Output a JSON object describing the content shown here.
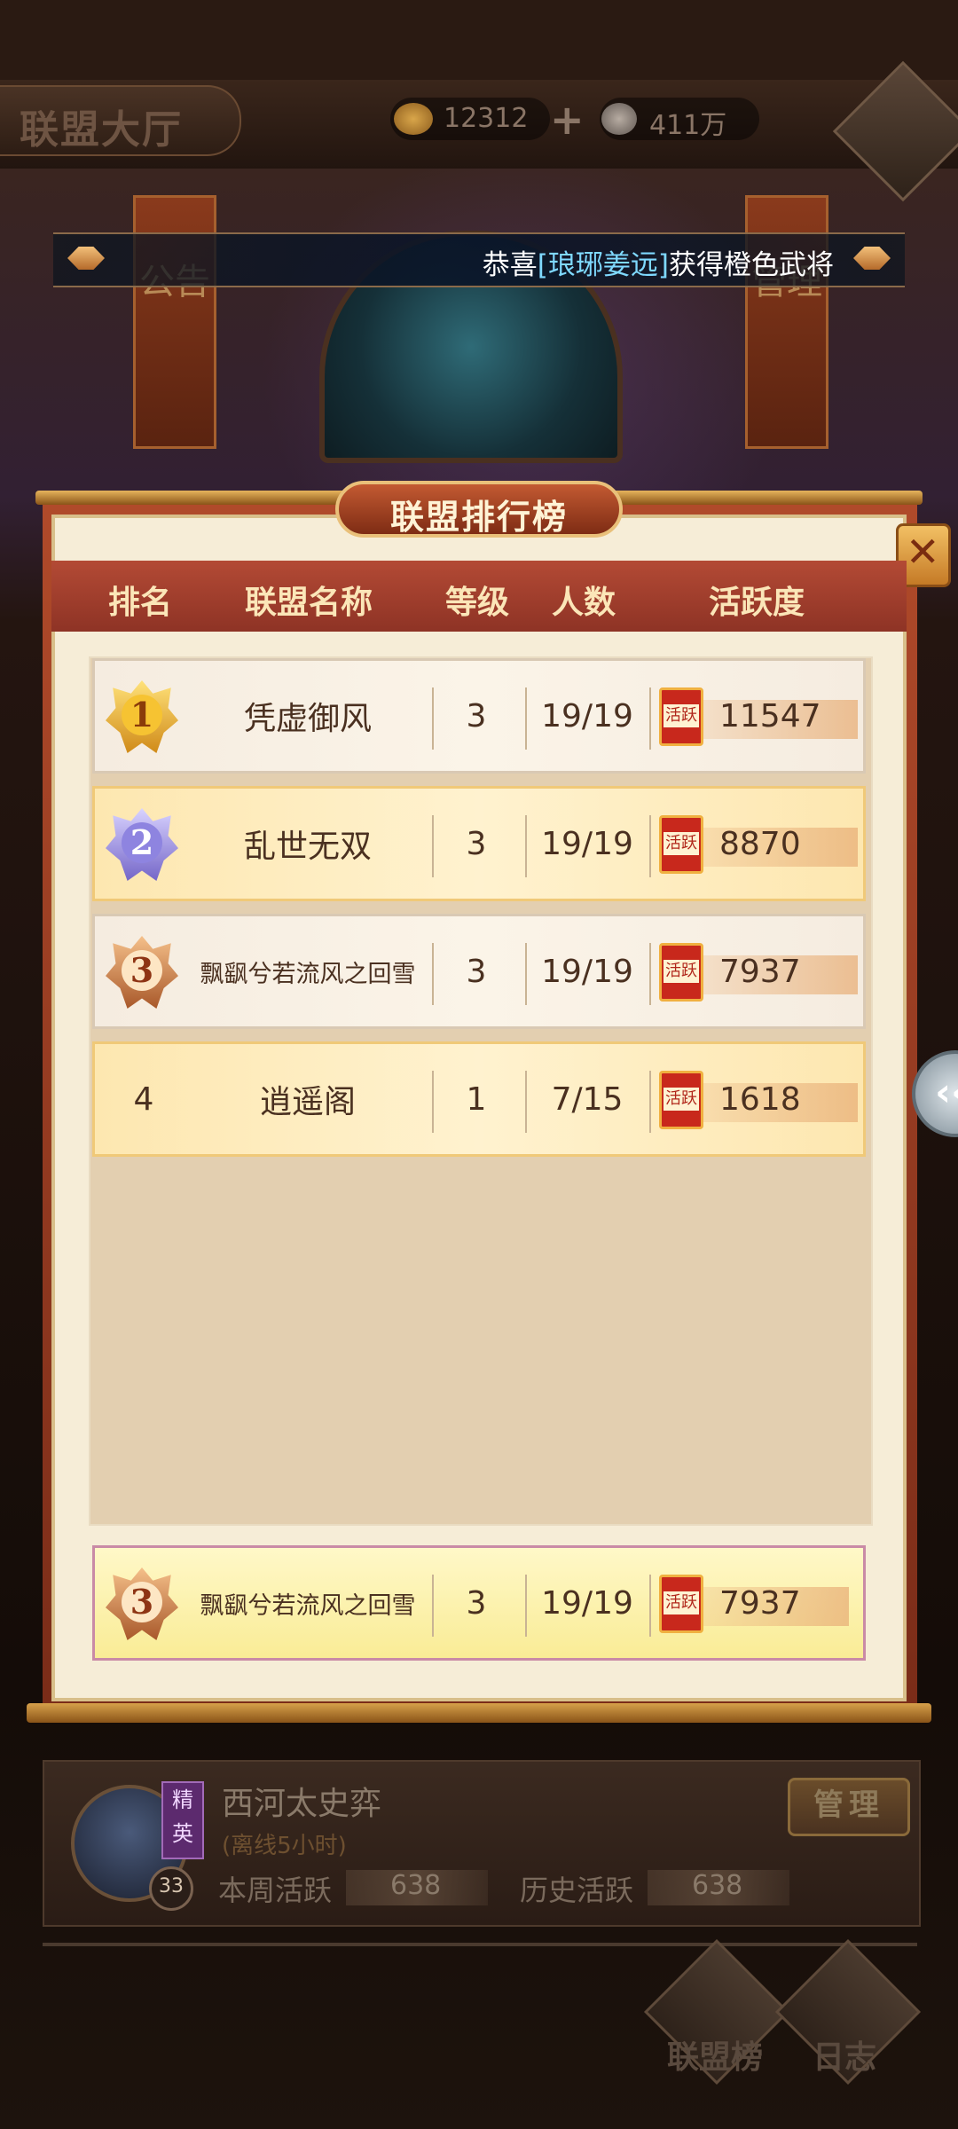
{
  "top_bar": {
    "title": "联盟大厅",
    "gold_value": "12312",
    "silver_value": "411万"
  },
  "hall": {
    "left_banner": "公告",
    "right_banner": "管理"
  },
  "notice": {
    "prefix": "恭喜",
    "highlight": "[琅琊姜远]",
    "suffix": "获得橙色武将"
  },
  "ranking_panel": {
    "title": "联盟排行榜",
    "columns": [
      "排名",
      "联盟名称",
      "等级",
      "人数",
      "活跃度"
    ],
    "active_icon_label": "活跃",
    "rows": [
      {
        "rank": "1",
        "name": "凭虚御风",
        "level": "3",
        "members": "19/19",
        "activity": "11547"
      },
      {
        "rank": "2",
        "name": "乱世无双",
        "level": "3",
        "members": "19/19",
        "activity": "8870"
      },
      {
        "rank": "3",
        "name": "飘飖兮若流风之回雪",
        "level": "3",
        "members": "19/19",
        "activity": "7937"
      },
      {
        "rank": "4",
        "name": "逍遥阁",
        "level": "1",
        "members": "7/15",
        "activity": "1618"
      }
    ],
    "my_alliance": {
      "rank": "3",
      "name": "飘飖兮若流风之回雪",
      "level": "3",
      "members": "19/19",
      "activity": "7937"
    }
  },
  "member": {
    "name": "西河太史弈",
    "title_badge": "精英",
    "status": "(离线5小时)",
    "level": "33",
    "weekly_label": "本周活跃",
    "weekly_value": "638",
    "history_label": "历史活跃",
    "history_value": "638",
    "manage_label": "管理"
  },
  "bottom_nav": {
    "rank_label": "联盟榜",
    "log_label": "日志"
  }
}
